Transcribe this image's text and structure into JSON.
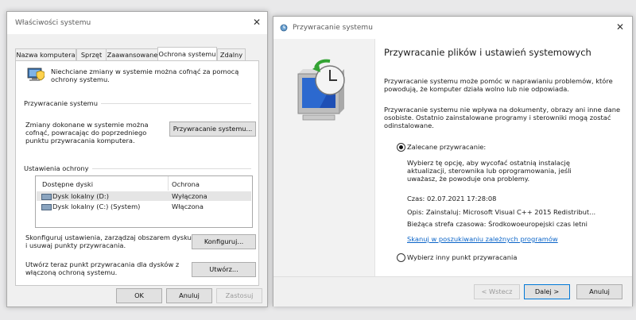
{
  "left_window": {
    "title": "Właściwości systemu",
    "tabs": [
      "Nazwa komputera",
      "Sprzęt",
      "Zaawansowane",
      "Ochrona systemu",
      "Zdalny"
    ],
    "intro_text_1": "Niechciane zmiany w systemie można cofnąć za pomocą",
    "intro_text_2": "ochrony systemu.",
    "restore_group_title": "Przywracanie systemu",
    "restore_text_1": "Zmiany dokonane w systemie można",
    "restore_text_2": "cofnąć, powracając do poprzedniego",
    "restore_text_3": "punktu przywracania komputera.",
    "restore_button": "Przywracanie systemu...",
    "protection_group_title": "Ustawienia ochrony",
    "table_headers": [
      "Dostępne dyski",
      "Ochrona"
    ],
    "drives": [
      {
        "name": "Dysk lokalny (D:)",
        "status": "Wyłączona"
      },
      {
        "name": "Dysk lokalny (C:) (System)",
        "status": "Włączona"
      }
    ],
    "configure_text_1": "Skonfiguruj ustawienia, zarządzaj obszarem dysku",
    "configure_text_2": "i usuwaj punkty przywracania.",
    "configure_button": "Konfiguruj...",
    "create_text_1": "Utwórz teraz punkt przywracania dla dysków z",
    "create_text_2": "włączoną ochroną systemu.",
    "create_button": "Utwórz...",
    "ok_button": "OK",
    "cancel_button": "Anuluj",
    "apply_button": "Zastosuj"
  },
  "right_window": {
    "title": "Przywracanie systemu",
    "heading": "Przywracanie plików i ustawień systemowych",
    "para1_1": "Przywracanie systemu może pomóc w naprawianiu problemów, które",
    "para1_2": "powodują, że komputer działa wolno lub nie odpowiada.",
    "para2_1": "Przywracanie systemu nie wpływa na dokumenty, obrazy ani inne dane",
    "para2_2": "osobiste. Ostatnio zainstalowane programy i sterowniki mogą zostać",
    "para2_3": "odinstalowane.",
    "recommended_label": "Zalecane przywracanie:",
    "rec_desc_1": "Wybierz tę opcję, aby wycofać ostatnią instalację",
    "rec_desc_2": "aktualizacji, sterownika lub oprogramowania, jeśli",
    "rec_desc_3": "uważasz, że powoduje ona problemy.",
    "time_line": "Czas: 02.07.2021 17:28:08",
    "desc_line": "Opis: Zainstaluj: Microsoft Visual C++ 2015 Redistribut...",
    "tz_line": "Bieżąca strefa czasowa: Środkowoeuropejski czas letni",
    "scan_link": "Skanuj w poszukiwaniu zależnych programów",
    "other_label": "Wybierz inny punkt przywracania",
    "back_button": "< Wstecz",
    "next_button": "Dalej >",
    "cancel_button": "Anuluj"
  },
  "colors": {
    "accent_link": "#0a64c8",
    "tab_text_active": "#000000",
    "page_bg": "#ffffff",
    "dialog_bg": "#f0f0f0"
  },
  "icons": [
    "close-icon",
    "system-restore-icon",
    "shield-computer-icon",
    "drive-icon"
  ]
}
